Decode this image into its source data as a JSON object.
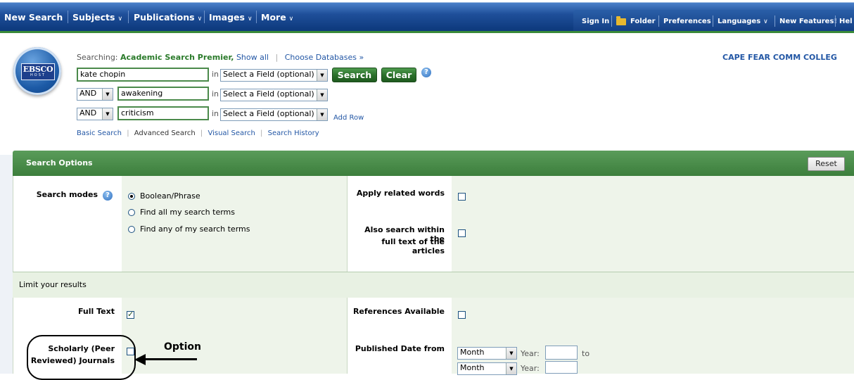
{
  "topnav": {
    "items": [
      "New Search",
      "Subjects",
      "Publications",
      "Images",
      "More"
    ],
    "right": [
      "Sign In",
      "Folder",
      "Preferences",
      "Languages",
      "New Features!",
      "Hel"
    ]
  },
  "logo": {
    "line1": "EBSCO",
    "line2": "HOST"
  },
  "header": {
    "searching_label": "Searching:",
    "database": "Academic Search Premier,",
    "show_all": "Show all",
    "choose_db": "Choose Databases »",
    "institution": "CAPE FEAR COMM COLLEG"
  },
  "search": {
    "rows": [
      {
        "bool": "",
        "term": "kate chopin",
        "in": "in",
        "field": "Select a Field (optional)"
      },
      {
        "bool": "AND",
        "term": "awakening",
        "in": "in",
        "field": "Select a Field (optional)"
      },
      {
        "bool": "AND",
        "term": "criticism",
        "in": "in",
        "field": "Select a Field (optional)"
      }
    ],
    "search_button": "Search",
    "clear_button": "Clear",
    "help": "?",
    "add_row": "Add Row",
    "links": [
      "Basic Search",
      "Advanced Search",
      "Visual Search",
      "Search History"
    ]
  },
  "options": {
    "title": "Search Options",
    "reset": "Reset",
    "search_modes_label": "Search modes",
    "modes": [
      {
        "label": "Boolean/Phrase",
        "selected": true
      },
      {
        "label": "Find all my search terms",
        "selected": false
      },
      {
        "label": "Find any of my search terms",
        "selected": false
      }
    ],
    "related_words": "Apply related words",
    "full_text_search_l1": "Also search within the",
    "full_text_search_l2": "full text of the articles"
  },
  "limits": {
    "title": "Limit your results",
    "full_text": "Full Text",
    "full_text_checked": true,
    "scholarly_l1": "Scholarly (Peer",
    "scholarly_l2": "Reviewed) Journals",
    "references": "References Available",
    "published_from": "Published Date from",
    "month": "Month",
    "year_label": "Year:",
    "to": "to"
  },
  "annotation": {
    "label": "Option"
  }
}
